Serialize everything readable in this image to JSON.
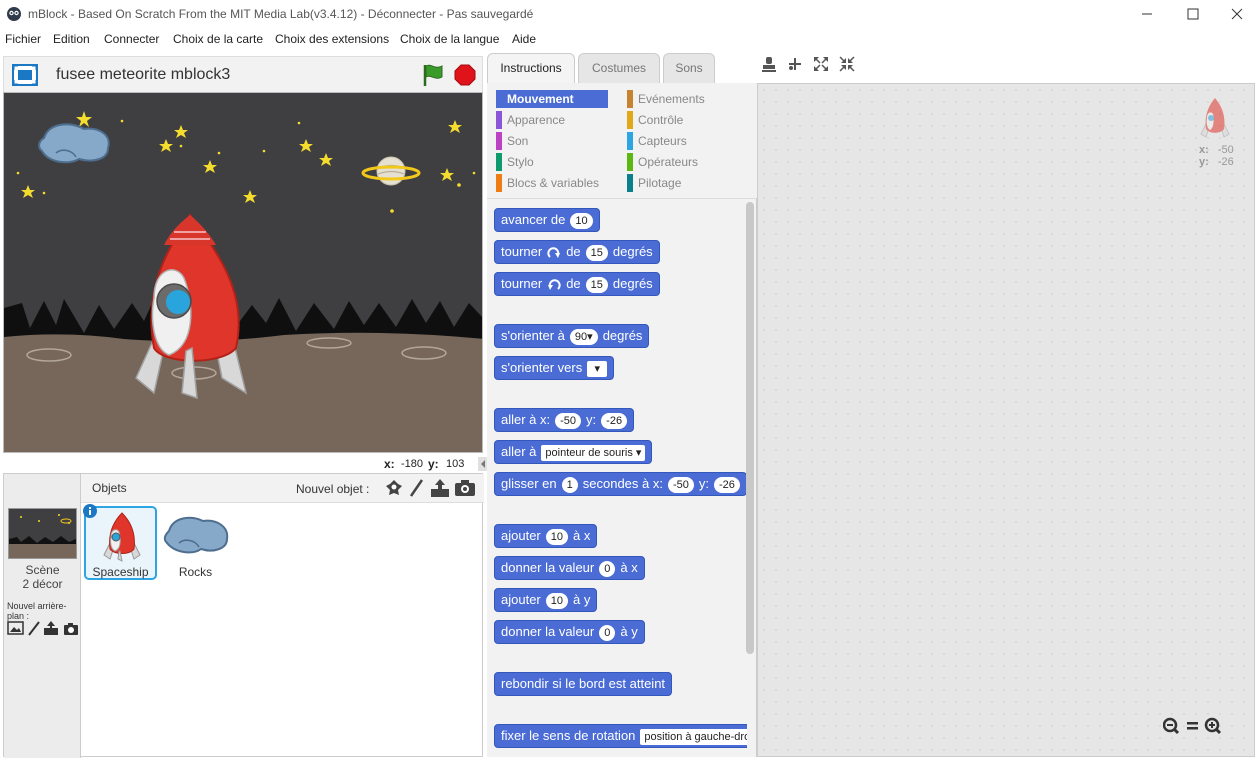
{
  "window": {
    "title": "mBlock - Based On Scratch From the MIT Media Lab(v3.4.12) - Déconnecter - Pas sauvegardé"
  },
  "menu": [
    "Fichier",
    "Edition",
    "Connecter",
    "Choix de la carte",
    "Choix des extensions",
    "Choix de la langue",
    "Aide"
  ],
  "stage": {
    "project_name": "fusee meteorite mblock3",
    "coords": {
      "x_label": "x:",
      "x": "-180",
      "y_label": "y:",
      "y": "103"
    }
  },
  "objects": {
    "header": "Objets",
    "new_object": "Nouvel objet :",
    "scene_label": "Scène",
    "scene_count": "2 décor",
    "new_backdrop": "Nouvel arrière-plan :",
    "sprites": [
      {
        "name": "Spaceship",
        "selected": true
      },
      {
        "name": "Rocks",
        "selected": false
      }
    ]
  },
  "tabs": [
    "Instructions",
    "Costumes",
    "Sons"
  ],
  "categories": {
    "left": [
      {
        "label": "Mouvement",
        "color": "#4a6cd4",
        "active": true
      },
      {
        "label": "Apparence",
        "color": "#8a55d7"
      },
      {
        "label": "Son",
        "color": "#bb42c3"
      },
      {
        "label": "Stylo",
        "color": "#0e9a6c"
      },
      {
        "label": "Blocs & variables",
        "color": "#ee7d16"
      }
    ],
    "right": [
      {
        "label": "Evénements",
        "color": "#c88330"
      },
      {
        "label": "Contrôle",
        "color": "#e1a91a"
      },
      {
        "label": "Capteurs",
        "color": "#2ca5e2"
      },
      {
        "label": "Opérateurs",
        "color": "#5cb712"
      },
      {
        "label": "Pilotage",
        "color": "#0b7f8c"
      }
    ]
  },
  "blocks": {
    "move": {
      "a": "avancer de",
      "v": "10"
    },
    "turn_right": {
      "a": "tourner",
      "b": "de",
      "v": "15",
      "c": "degrés"
    },
    "turn_left": {
      "a": "tourner",
      "b": "de",
      "v": "15",
      "c": "degrés"
    },
    "point_dir": {
      "a": "s'orienter à",
      "v": "90",
      "c": "degrés"
    },
    "point_towards": {
      "a": "s'orienter vers"
    },
    "goto_xy": {
      "a": "aller à x:",
      "x": "-50",
      "b": "y:",
      "y": "-26"
    },
    "goto": {
      "a": "aller à",
      "v": "pointeur de souris"
    },
    "glide": {
      "a": "glisser en",
      "v": "1",
      "b": "secondes à x:",
      "x": "-50",
      "c": "y:",
      "y": "-26"
    },
    "change_x": {
      "a": "ajouter",
      "v": "10",
      "b": "à x"
    },
    "set_x": {
      "a": "donner la valeur",
      "v": "0",
      "b": "à x"
    },
    "change_y": {
      "a": "ajouter",
      "v": "10",
      "b": "à y"
    },
    "set_y": {
      "a": "donner la valeur",
      "v": "0",
      "b": "à y"
    },
    "bounce": {
      "a": "rebondir si le bord est atteint"
    },
    "rotation_style": {
      "a": "fixer le sens de rotation",
      "v": "position à gauche-droite"
    }
  },
  "script_area": {
    "x_label": "x:",
    "x": "-50",
    "y_label": "y:",
    "y": "-26"
  }
}
